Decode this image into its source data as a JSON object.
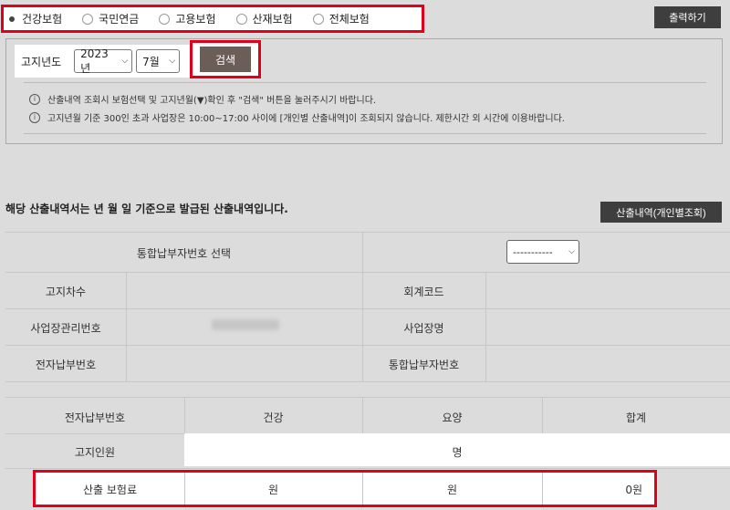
{
  "radio_options": [
    {
      "label": "건강보험",
      "checked": true
    },
    {
      "label": "국민연금",
      "checked": false
    },
    {
      "label": "고용보험",
      "checked": false
    },
    {
      "label": "산재보험",
      "checked": false
    },
    {
      "label": "전체보험",
      "checked": false
    }
  ],
  "print_button": "출력하기",
  "search": {
    "label": "고지년도",
    "year": "2023년",
    "month": "7월",
    "button": "검색"
  },
  "notices": [
    "산출내역 조회시 보험선택 및 고지년월(▼)확인 후 \"검색\" 버튼을 눌러주시기 바랍니다.",
    "고지년월 기준 300인 초과 사업장은 10:00~17:00 사이에 [개인별 산출내역]이 조회되지 않습니다. 제한시간 외 시간에 이용바랍니다."
  ],
  "main_title": "해당 산출내역서는 년 월 일 기준으로 발급된 산출내역입니다.",
  "detail_button": "산출내역(개인별조회)",
  "info_table": {
    "select_label": "통합납부자번호 선택",
    "select_value": "-----------",
    "notice_no_label": "고지차수",
    "account_code_label": "회계코드",
    "workplace_no_label": "사업장관리번호",
    "workplace_name_label": "사업장명",
    "e_payment_label": "전자납부번호",
    "integrated_payer_label": "통합납부자번호"
  },
  "calc_table": {
    "headers": [
      "전자납부번호",
      "건강",
      "요양",
      "합계"
    ],
    "notified_label": "고지인원",
    "notified_unit": "명",
    "premium_label": "산출 보험료",
    "premium_health": "원",
    "premium_care": "원",
    "premium_total": "0원"
  }
}
